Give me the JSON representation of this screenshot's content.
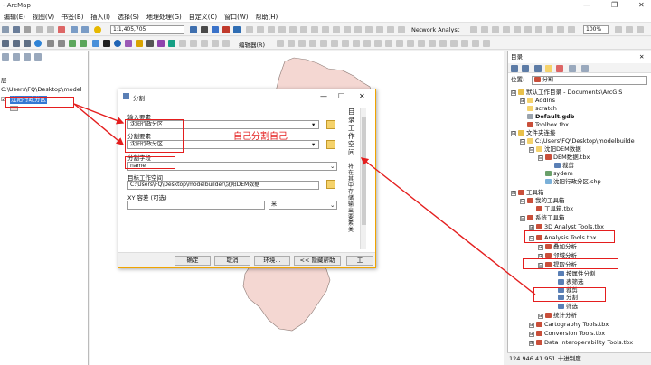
{
  "app": {
    "title": "- ArcMap"
  },
  "menu": [
    "编辑(E)",
    "视图(V)",
    "书签(B)",
    "插入(I)",
    "选择(S)",
    "地理处理(G)",
    "自定义(C)",
    "窗口(W)",
    "帮助(H)"
  ],
  "toolbar": {
    "scale": "1:1,405,705",
    "network_analyst": "Network Analyst",
    "editor": "编辑器(R)",
    "zoom": "100%"
  },
  "toc": {
    "path": "C:\\Users\\FQ\\Desktop\\model",
    "layer": "沈阳行政分区"
  },
  "dialog": {
    "title": "分割",
    "input_label": "输入要素",
    "input_value": "沈阳行政分区",
    "split_label": "分割要素",
    "split_value": "沈阳行政分区",
    "field_label": "分割字段",
    "field_value": "name",
    "workspace_label": "目标工作空间",
    "workspace_value": "C:\\Users\\FQ\\Desktop\\modelbuilder\\沈阳DEM数据",
    "xy_label": "XY 容差 (可选)",
    "xy_unit": "米",
    "ok": "确定",
    "cancel": "取消",
    "env": "环境...",
    "hide_help": "<< 隐藏帮助",
    "tool_help": "工",
    "side_text": "目录工作空间",
    "side_text2": "将在其中存储输出要素类"
  },
  "annotation": {
    "note": "自己分割自己"
  },
  "catalog": {
    "title": "目录",
    "location_label": "位置:",
    "location_value": "分割",
    "items": [
      {
        "label": "默认工作目录 - Documents\\ArcGIS",
        "level": 0,
        "pm": "⊟",
        "icon": "#e8c04a"
      },
      {
        "label": "AddIns",
        "level": 1,
        "pm": "⊞",
        "icon": "#f5d26b"
      },
      {
        "label": "scratch",
        "level": 1,
        "pm": "",
        "icon": "#f5d26b"
      },
      {
        "label": "Default.gdb",
        "level": 1,
        "pm": "",
        "icon": "#9aa3ad",
        "bold": true
      },
      {
        "label": "Toolbox.tbx",
        "level": 1,
        "pm": "",
        "icon": "#c94f3a"
      },
      {
        "label": "文件夹连接",
        "level": 0,
        "pm": "⊟",
        "icon": "#e8c04a"
      },
      {
        "label": "C:\\Users\\FQ\\Desktop\\modelbuilde",
        "level": 1,
        "pm": "⊟",
        "icon": "#f5d26b"
      },
      {
        "label": "沈阳DEM数据",
        "level": 2,
        "pm": "⊟",
        "icon": "#f5d26b"
      },
      {
        "label": "DEM数据.tbx",
        "level": 3,
        "pm": "⊟",
        "icon": "#c94f3a"
      },
      {
        "label": "裁剪",
        "level": 4,
        "pm": "",
        "icon": "#5a7fb5"
      },
      {
        "label": "sydem",
        "level": 3,
        "pm": "",
        "icon": "#6aa06a"
      },
      {
        "label": "沈阳行政分区.shp",
        "level": 3,
        "pm": "",
        "icon": "#7ab0d8"
      },
      {
        "label": "工具箱",
        "level": 0,
        "pm": "⊟",
        "icon": "#c94f3a"
      },
      {
        "label": "我的工具箱",
        "level": 1,
        "pm": "⊟",
        "icon": "#c94f3a"
      },
      {
        "label": "工具箱.tbx",
        "level": 2,
        "pm": "",
        "icon": "#c94f3a"
      },
      {
        "label": "系统工具箱",
        "level": 1,
        "pm": "⊟",
        "icon": "#c94f3a"
      },
      {
        "label": "3D Analyst Tools.tbx",
        "level": 2,
        "pm": "⊞",
        "icon": "#c94f3a"
      },
      {
        "label": "Analysis Tools.tbx",
        "level": 2,
        "pm": "⊟",
        "icon": "#c94f3a"
      },
      {
        "label": "叠加分析",
        "level": 3,
        "pm": "⊞",
        "icon": "#c94f3a"
      },
      {
        "label": "邻域分析",
        "level": 3,
        "pm": "⊞",
        "icon": "#c94f3a"
      },
      {
        "label": "提取分析",
        "level": 3,
        "pm": "⊟",
        "icon": "#c94f3a"
      },
      {
        "label": "按属性分割",
        "level": 4,
        "pm": "",
        "icon": "#5a7fb5"
      },
      {
        "label": "表筛选",
        "level": 4,
        "pm": "",
        "icon": "#5a7fb5"
      },
      {
        "label": "裁剪",
        "level": 4,
        "pm": "",
        "icon": "#5a7fb5"
      },
      {
        "label": "分割",
        "level": 4,
        "pm": "",
        "icon": "#5a7fb5"
      },
      {
        "label": "筛选",
        "level": 4,
        "pm": "",
        "icon": "#5a7fb5"
      },
      {
        "label": "统计分析",
        "level": 3,
        "pm": "⊞",
        "icon": "#c94f3a"
      },
      {
        "label": "Cartography Tools.tbx",
        "level": 2,
        "pm": "⊞",
        "icon": "#c94f3a"
      },
      {
        "label": "Conversion Tools.tbx",
        "level": 2,
        "pm": "⊞",
        "icon": "#c94f3a"
      },
      {
        "label": "Data Interoperability Tools.tbx",
        "level": 2,
        "pm": "⊞",
        "icon": "#c94f3a"
      }
    ]
  },
  "status": {
    "coords": "124.946  41.951 十进制度"
  }
}
